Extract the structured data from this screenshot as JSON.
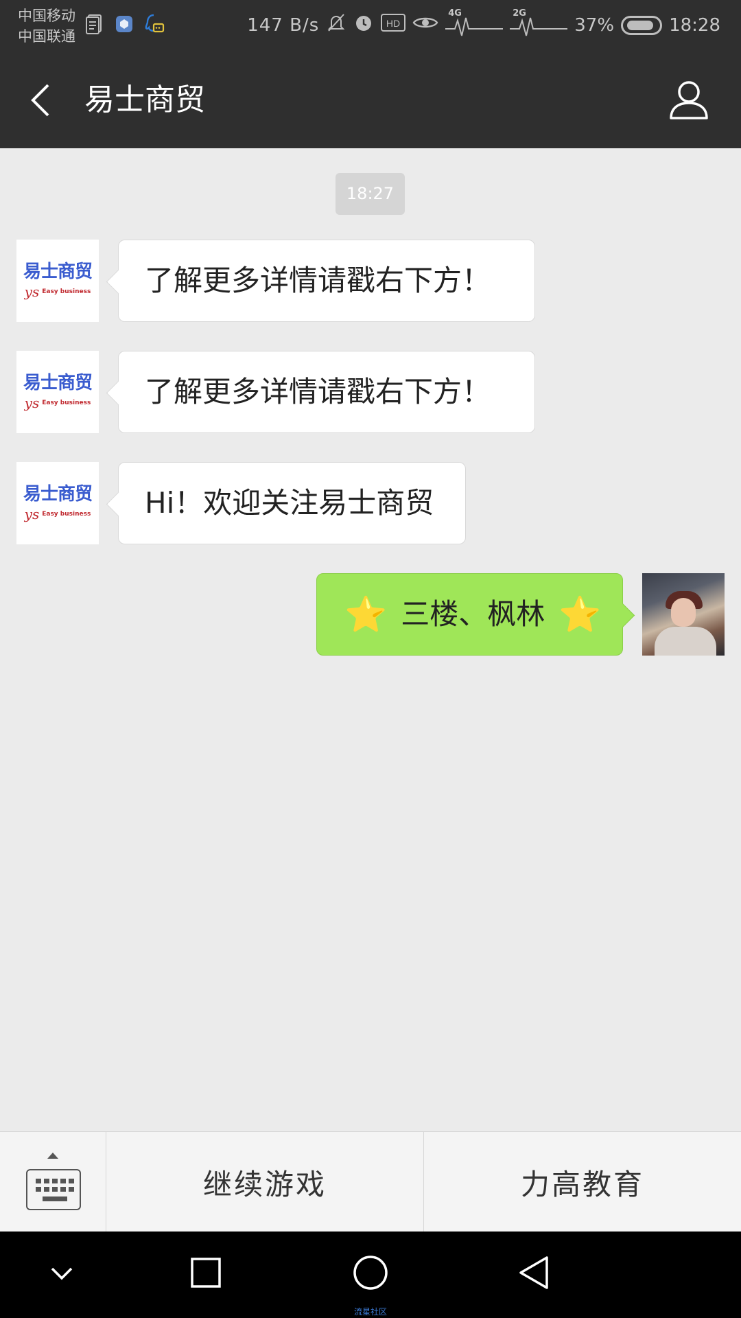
{
  "status_bar": {
    "carrier_1": "中国移动",
    "carrier_2": "中国联通",
    "net_speed": "147 B/s",
    "hd_label": "HD",
    "signal_1_label": "4G",
    "signal_2_label": "2G",
    "battery": "37%",
    "time": "18:28"
  },
  "header": {
    "title": "易士商贸",
    "back_icon": "chevron-left-icon",
    "profile_icon": "person-icon"
  },
  "chat": {
    "timestamp": "18:27",
    "brand_avatar": {
      "name": "易士商贸",
      "mark": "ys",
      "tagline": "Easy business"
    },
    "messages": [
      {
        "side": "left",
        "text": "了解更多详情请戳右下方！"
      },
      {
        "side": "left",
        "text": "了解更多详情请戳右下方！"
      },
      {
        "side": "left",
        "text": "Hi！欢迎关注易士商贸"
      },
      {
        "side": "right",
        "text": "三楼、枫林",
        "emoji": "⭐"
      }
    ]
  },
  "menu": {
    "keyboard_icon": "keyboard-icon",
    "items": [
      {
        "label": "继续游戏"
      },
      {
        "label": "力高教育"
      }
    ]
  },
  "nav": {
    "down_icon": "chevron-down-icon",
    "recents_icon": "square-icon",
    "home_icon": "circle-icon",
    "back_icon": "triangle-back-icon",
    "watermark": "流星社区"
  },
  "colors": {
    "header_bg": "#2f2f2f",
    "chat_bg": "#ebebeb",
    "sent_bubble": "#9fe658",
    "brand_blue": "#3a5ccf",
    "brand_red": "#c0282e"
  }
}
